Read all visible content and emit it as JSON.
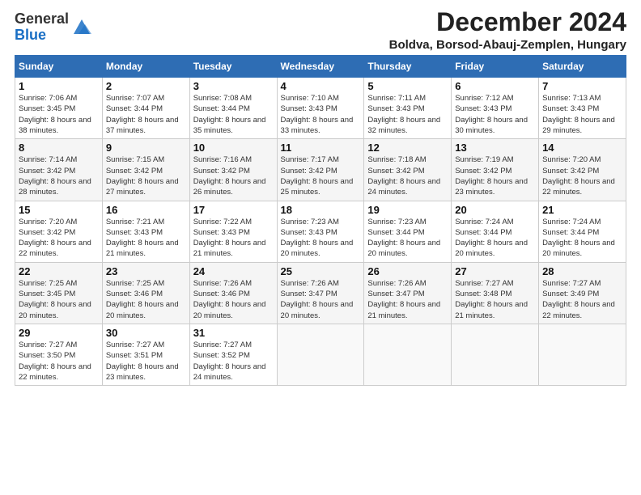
{
  "header": {
    "logo_general": "General",
    "logo_blue": "Blue",
    "title": "December 2024",
    "subtitle": "Boldva, Borsod-Abauj-Zemplen, Hungary"
  },
  "calendar": {
    "days_of_week": [
      "Sunday",
      "Monday",
      "Tuesday",
      "Wednesday",
      "Thursday",
      "Friday",
      "Saturday"
    ],
    "weeks": [
      [
        {
          "day": "1",
          "sunrise": "Sunrise: 7:06 AM",
          "sunset": "Sunset: 3:45 PM",
          "daylight": "Daylight: 8 hours and 38 minutes."
        },
        {
          "day": "2",
          "sunrise": "Sunrise: 7:07 AM",
          "sunset": "Sunset: 3:44 PM",
          "daylight": "Daylight: 8 hours and 37 minutes."
        },
        {
          "day": "3",
          "sunrise": "Sunrise: 7:08 AM",
          "sunset": "Sunset: 3:44 PM",
          "daylight": "Daylight: 8 hours and 35 minutes."
        },
        {
          "day": "4",
          "sunrise": "Sunrise: 7:10 AM",
          "sunset": "Sunset: 3:43 PM",
          "daylight": "Daylight: 8 hours and 33 minutes."
        },
        {
          "day": "5",
          "sunrise": "Sunrise: 7:11 AM",
          "sunset": "Sunset: 3:43 PM",
          "daylight": "Daylight: 8 hours and 32 minutes."
        },
        {
          "day": "6",
          "sunrise": "Sunrise: 7:12 AM",
          "sunset": "Sunset: 3:43 PM",
          "daylight": "Daylight: 8 hours and 30 minutes."
        },
        {
          "day": "7",
          "sunrise": "Sunrise: 7:13 AM",
          "sunset": "Sunset: 3:43 PM",
          "daylight": "Daylight: 8 hours and 29 minutes."
        }
      ],
      [
        {
          "day": "8",
          "sunrise": "Sunrise: 7:14 AM",
          "sunset": "Sunset: 3:42 PM",
          "daylight": "Daylight: 8 hours and 28 minutes."
        },
        {
          "day": "9",
          "sunrise": "Sunrise: 7:15 AM",
          "sunset": "Sunset: 3:42 PM",
          "daylight": "Daylight: 8 hours and 27 minutes."
        },
        {
          "day": "10",
          "sunrise": "Sunrise: 7:16 AM",
          "sunset": "Sunset: 3:42 PM",
          "daylight": "Daylight: 8 hours and 26 minutes."
        },
        {
          "day": "11",
          "sunrise": "Sunrise: 7:17 AM",
          "sunset": "Sunset: 3:42 PM",
          "daylight": "Daylight: 8 hours and 25 minutes."
        },
        {
          "day": "12",
          "sunrise": "Sunrise: 7:18 AM",
          "sunset": "Sunset: 3:42 PM",
          "daylight": "Daylight: 8 hours and 24 minutes."
        },
        {
          "day": "13",
          "sunrise": "Sunrise: 7:19 AM",
          "sunset": "Sunset: 3:42 PM",
          "daylight": "Daylight: 8 hours and 23 minutes."
        },
        {
          "day": "14",
          "sunrise": "Sunrise: 7:20 AM",
          "sunset": "Sunset: 3:42 PM",
          "daylight": "Daylight: 8 hours and 22 minutes."
        }
      ],
      [
        {
          "day": "15",
          "sunrise": "Sunrise: 7:20 AM",
          "sunset": "Sunset: 3:42 PM",
          "daylight": "Daylight: 8 hours and 22 minutes."
        },
        {
          "day": "16",
          "sunrise": "Sunrise: 7:21 AM",
          "sunset": "Sunset: 3:43 PM",
          "daylight": "Daylight: 8 hours and 21 minutes."
        },
        {
          "day": "17",
          "sunrise": "Sunrise: 7:22 AM",
          "sunset": "Sunset: 3:43 PM",
          "daylight": "Daylight: 8 hours and 21 minutes."
        },
        {
          "day": "18",
          "sunrise": "Sunrise: 7:23 AM",
          "sunset": "Sunset: 3:43 PM",
          "daylight": "Daylight: 8 hours and 20 minutes."
        },
        {
          "day": "19",
          "sunrise": "Sunrise: 7:23 AM",
          "sunset": "Sunset: 3:44 PM",
          "daylight": "Daylight: 8 hours and 20 minutes."
        },
        {
          "day": "20",
          "sunrise": "Sunrise: 7:24 AM",
          "sunset": "Sunset: 3:44 PM",
          "daylight": "Daylight: 8 hours and 20 minutes."
        },
        {
          "day": "21",
          "sunrise": "Sunrise: 7:24 AM",
          "sunset": "Sunset: 3:44 PM",
          "daylight": "Daylight: 8 hours and 20 minutes."
        }
      ],
      [
        {
          "day": "22",
          "sunrise": "Sunrise: 7:25 AM",
          "sunset": "Sunset: 3:45 PM",
          "daylight": "Daylight: 8 hours and 20 minutes."
        },
        {
          "day": "23",
          "sunrise": "Sunrise: 7:25 AM",
          "sunset": "Sunset: 3:46 PM",
          "daylight": "Daylight: 8 hours and 20 minutes."
        },
        {
          "day": "24",
          "sunrise": "Sunrise: 7:26 AM",
          "sunset": "Sunset: 3:46 PM",
          "daylight": "Daylight: 8 hours and 20 minutes."
        },
        {
          "day": "25",
          "sunrise": "Sunrise: 7:26 AM",
          "sunset": "Sunset: 3:47 PM",
          "daylight": "Daylight: 8 hours and 20 minutes."
        },
        {
          "day": "26",
          "sunrise": "Sunrise: 7:26 AM",
          "sunset": "Sunset: 3:47 PM",
          "daylight": "Daylight: 8 hours and 21 minutes."
        },
        {
          "day": "27",
          "sunrise": "Sunrise: 7:27 AM",
          "sunset": "Sunset: 3:48 PM",
          "daylight": "Daylight: 8 hours and 21 minutes."
        },
        {
          "day": "28",
          "sunrise": "Sunrise: 7:27 AM",
          "sunset": "Sunset: 3:49 PM",
          "daylight": "Daylight: 8 hours and 22 minutes."
        }
      ],
      [
        {
          "day": "29",
          "sunrise": "Sunrise: 7:27 AM",
          "sunset": "Sunset: 3:50 PM",
          "daylight": "Daylight: 8 hours and 22 minutes."
        },
        {
          "day": "30",
          "sunrise": "Sunrise: 7:27 AM",
          "sunset": "Sunset: 3:51 PM",
          "daylight": "Daylight: 8 hours and 23 minutes."
        },
        {
          "day": "31",
          "sunrise": "Sunrise: 7:27 AM",
          "sunset": "Sunset: 3:52 PM",
          "daylight": "Daylight: 8 hours and 24 minutes."
        },
        null,
        null,
        null,
        null
      ]
    ]
  }
}
